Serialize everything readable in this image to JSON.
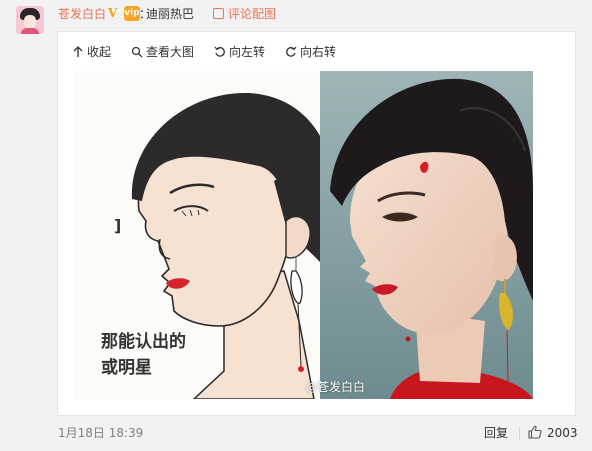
{
  "post": {
    "username": "苍发白白",
    "vip_badge": "vip",
    "separator": "：",
    "topic": "迪丽热巴",
    "comment_action": "评论配图"
  },
  "toolbar": {
    "collapse": "收起",
    "view_large": "查看大图",
    "rotate_left": "向左转",
    "rotate_right": "向右转"
  },
  "image": {
    "left_caption_line1": "那能认出的",
    "left_caption_line2": "或明星",
    "watermark": "苍发白白"
  },
  "footer": {
    "time": "1月18日 18:39",
    "reply": "回复",
    "likes": "2003"
  },
  "colors": {
    "accent": "#eb7350",
    "lip_red": "#d4232b",
    "hair": "#2a2a2a"
  }
}
